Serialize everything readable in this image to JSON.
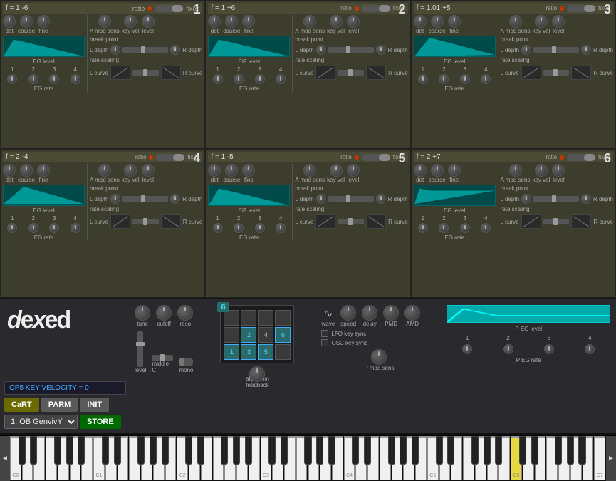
{
  "app_title": "dexed",
  "operators": [
    {
      "id": 1,
      "number": "1",
      "freq": "f = 1 -6",
      "ratio": "ratio",
      "fixed": "fixed",
      "eg_shape": "attack",
      "det_label": "det",
      "coarse_label": "coarse",
      "fine_label": "fine",
      "a_mod_sens": "A mod sens",
      "key_vel": "key vel",
      "level": "level",
      "eg_level": "EG level",
      "eg_rate": "EG rate",
      "break_point": "break point",
      "l_depth": "L depth",
      "r_depth": "R depth",
      "rate_scaling": "rate scaling",
      "l_curve": "L curve",
      "r_curve": "R curve",
      "rate_numbers": [
        "1",
        "2",
        "3",
        "4"
      ],
      "level_numbers": [
        "1",
        "2",
        "3",
        "4"
      ]
    },
    {
      "id": 2,
      "number": "2",
      "freq": "f = 1 +6",
      "ratio": "ratio",
      "fixed": "fixed",
      "eg_shape": "attack",
      "det_label": "det",
      "coarse_label": "coarse",
      "fine_label": "fine",
      "a_mod_sens": "A mod sens",
      "key_vel": "key vel",
      "level": "level",
      "eg_level": "EG level",
      "eg_rate": "EG rate",
      "break_point": "break point",
      "l_depth": "L depth",
      "r_depth": "R depth",
      "rate_scaling": "rate scaling",
      "l_curve": "L curve",
      "r_curve": "R curve",
      "rate_numbers": [
        "1",
        "2",
        "3",
        "4"
      ],
      "level_numbers": [
        "1",
        "2",
        "3",
        "4"
      ]
    },
    {
      "id": 3,
      "number": "3",
      "freq": "f = 1.01 +5",
      "ratio": "ratio",
      "fixed": "fixed",
      "eg_shape": "decay",
      "det_label": "det",
      "coarse_label": "coarse",
      "fine_label": "fine",
      "a_mod_sens": "A mod sens",
      "key_vel": "key vel",
      "level": "level",
      "eg_level": "EG level",
      "eg_rate": "EG rate",
      "break_point": "break point",
      "l_depth": "L depth",
      "r_depth": "R depth",
      "rate_scaling": "rate scaling",
      "l_curve": "L curve",
      "r_curve": "R curve",
      "rate_numbers": [
        "1",
        "2",
        "3",
        "4"
      ],
      "level_numbers": [
        "1",
        "2",
        "3",
        "4"
      ]
    },
    {
      "id": 4,
      "number": "4",
      "freq": "f = 2 -4",
      "ratio": "ratio",
      "fixed": "fixed",
      "eg_shape": "decay",
      "det_label": "det",
      "coarse_label": "coarse",
      "fine_label": "fine",
      "a_mod_sens": "A mod sens",
      "key_vel": "key vel",
      "level": "level",
      "eg_level": "EG level",
      "eg_rate": "EG rate",
      "break_point": "break point",
      "l_depth": "L depth",
      "r_depth": "R depth",
      "rate_scaling": "rate scaling",
      "l_curve": "L curve",
      "r_curve": "R curve",
      "rate_numbers": [
        "1",
        "2",
        "3",
        "4"
      ],
      "level_numbers": [
        "1",
        "2",
        "3",
        "4"
      ]
    },
    {
      "id": 5,
      "number": "5",
      "freq": "f = 1 -5",
      "ratio": "ratio",
      "fixed": "fixed",
      "eg_shape": "attack",
      "det_label": "det",
      "coarse_label": "coarse",
      "fine_label": "fine",
      "a_mod_sens": "A mod sens",
      "key_vel": "key vel",
      "level": "level",
      "eg_level": "EG level",
      "eg_rate": "EG rate",
      "break_point": "break point",
      "l_depth": "L depth",
      "r_depth": "R depth",
      "rate_scaling": "rate scaling",
      "l_curve": "L curve",
      "r_curve": "R curve",
      "rate_numbers": [
        "1",
        "2",
        "3",
        "4"
      ],
      "level_numbers": [
        "1",
        "2",
        "3",
        "4"
      ]
    },
    {
      "id": 6,
      "number": "6",
      "freq": "f = 2 +7",
      "ratio": "ratio",
      "fixed": "fixed",
      "eg_shape": "flat",
      "det_label": "det",
      "coarse_label": "coarse",
      "fine_label": "fine",
      "a_mod_sens": "A mod sens",
      "key_vel": "key vel",
      "level": "level",
      "eg_level": "EG level",
      "eg_rate": "EG rate",
      "break_point": "break point",
      "l_depth": "L depth",
      "r_depth": "R depth",
      "rate_scaling": "rate scaling",
      "l_curve": "L curve",
      "r_curve": "R curve",
      "rate_numbers": [
        "1",
        "2",
        "3",
        "4"
      ],
      "level_numbers": [
        "1",
        "2",
        "3",
        "4"
      ]
    }
  ],
  "bottom": {
    "logo": "dexed",
    "op5_status": "OP5 KEY VELOCITY = 0",
    "buttons": {
      "cart": "CaRT",
      "parm": "PARM",
      "init": "INIT",
      "store": "STORE"
    },
    "preset_name": "1. OB GenvivY",
    "tune_label": "tune",
    "cutoff_label": "cutoff",
    "reso_label": "reso",
    "level_label": "level",
    "middle_c_label": "middle C",
    "mono_label": "mono",
    "algorithm_label": "algorithm",
    "feedback_label": "feedback",
    "algo_number": "6",
    "algo_cells": [
      {
        "row": 1,
        "col": 1,
        "active": false
      },
      {
        "row": 1,
        "col": 2,
        "active": false
      },
      {
        "row": 1,
        "col": 3,
        "active": false
      },
      {
        "row": 1,
        "col": 4,
        "active": false
      },
      {
        "row": 2,
        "col": 1,
        "active": false
      },
      {
        "row": 2,
        "col": 2,
        "active": true,
        "label": "2"
      },
      {
        "row": 2,
        "col": 3,
        "active": false,
        "label": "4"
      },
      {
        "row": 2,
        "col": 4,
        "active": true,
        "label": "6"
      },
      {
        "row": 3,
        "col": 1,
        "active": true,
        "label": "1"
      },
      {
        "row": 3,
        "col": 2,
        "active": true,
        "label": "3"
      },
      {
        "row": 3,
        "col": 3,
        "active": true,
        "label": "5"
      },
      {
        "row": 3,
        "col": 4,
        "active": false
      }
    ],
    "lfo": {
      "wave_label": "wave",
      "speed_label": "speed",
      "delay_label": "delay",
      "pmd_label": "PMD",
      "amd_label": "AMD",
      "p_mod_sens_label": "P mod sens",
      "lfo_key_sync": "LFO key sync",
      "osc_key_sync": "OSC key sync"
    },
    "peg": {
      "p_eg_level": "P EG level",
      "p_eg_rate": "P EG rate",
      "numbers": [
        "1",
        "2",
        "3",
        "4"
      ]
    }
  },
  "piano": {
    "arrow_left": "◄",
    "arrow_right": "►",
    "notes": [
      "C1",
      "",
      "C2",
      "",
      "C3",
      "",
      "C4",
      "",
      "C5",
      "",
      "C6",
      "",
      "C7"
    ],
    "highlighted_key": "C6"
  }
}
